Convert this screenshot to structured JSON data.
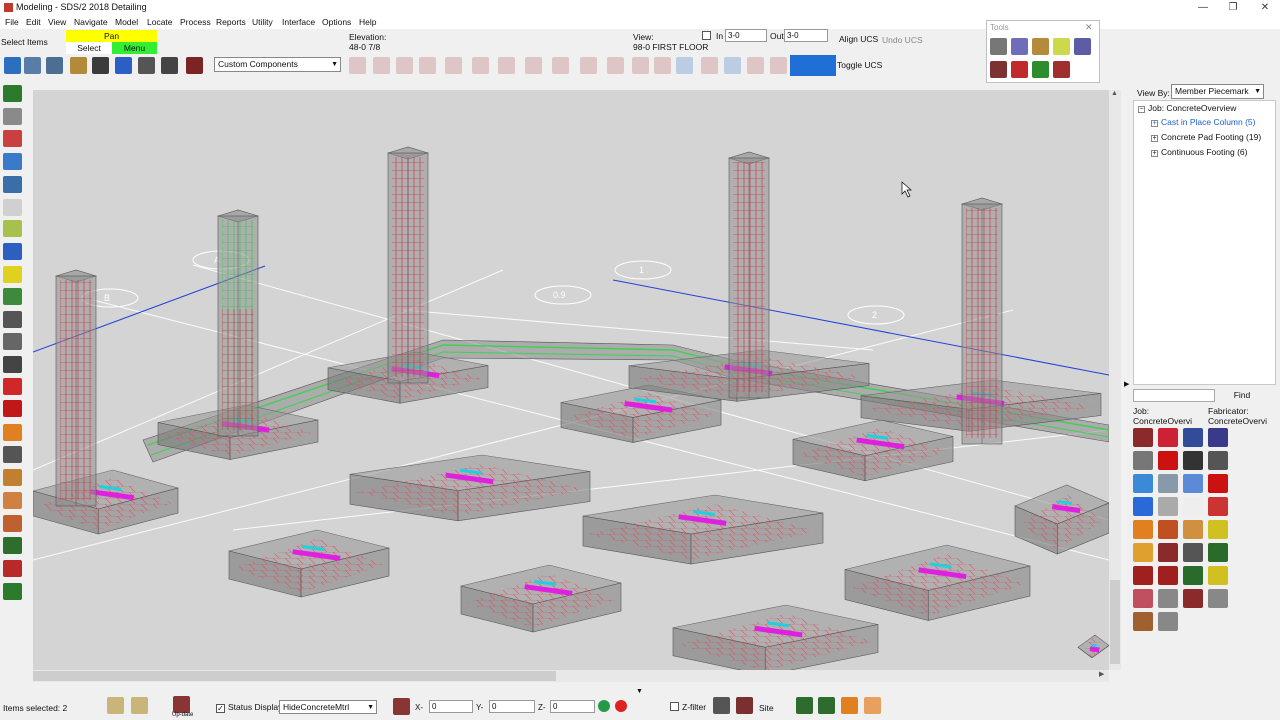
{
  "window": {
    "title": "Modeling - SDS/2 2018 Detailing",
    "minimize": "—",
    "maximize": "❐",
    "close": "✕"
  },
  "menu": [
    "File",
    "Edit",
    "View",
    "Navigate",
    "Model",
    "Locate",
    "Process",
    "Reports",
    "Utility",
    "Interface",
    "Options",
    "Help"
  ],
  "toolbar": {
    "select_items": "Select Items",
    "pan": "Pan",
    "select": "Select",
    "menu": "Menu",
    "elevation_label": "Elevation:",
    "elevation_value": "48-0 7/8",
    "view_label": "View:",
    "view_value": "98-0 FIRST FLOOR",
    "in_label": "In",
    "in_value": "3-0",
    "out_label": "Out",
    "out_value": "3-0",
    "align_ucs": "Align UCS",
    "undo_ucs": "Undo UCS",
    "toggle_ucs": "Toggle UCS",
    "components_dropdown": "Custom Components",
    "colors": {
      "pan": "#ffff00",
      "menu": "#33ee33",
      "toggle_ucs_icon": "#1f6fd6"
    }
  },
  "tools_palette": {
    "title": "Tools",
    "close": "✕"
  },
  "viewport": {
    "grid_labels": [
      "A",
      "B",
      "0.9",
      "1",
      "2"
    ]
  },
  "tree": {
    "view_by_label": "View By:",
    "view_by_value": "Member Piecemark",
    "root": "Job: ConcreteOverview",
    "items": [
      {
        "label": "Cast in Place Column (5)",
        "highlight": true
      },
      {
        "label": "Concrete Pad Footing (19)",
        "highlight": false
      },
      {
        "label": "Continuous Footing (6)",
        "highlight": false
      }
    ],
    "find_button": "Find",
    "job_label": "Job:",
    "job_value": "ConcreteOvervi",
    "fabricator_label": "Fabricator:",
    "fabricator_value": "ConcreteOvervi"
  },
  "status": {
    "items_selected": "Items selected: 2",
    "status_display_label": "Status Display",
    "status_display_value": "HideConcreteMtrl",
    "x_label": "X-",
    "x_value": "0",
    "y_label": "Y-",
    "y_value": "0",
    "z_label": "Z-",
    "z_value": "0",
    "z_filter_label": "Z-filter",
    "site_label": "Site",
    "update_label": "Up-date"
  }
}
